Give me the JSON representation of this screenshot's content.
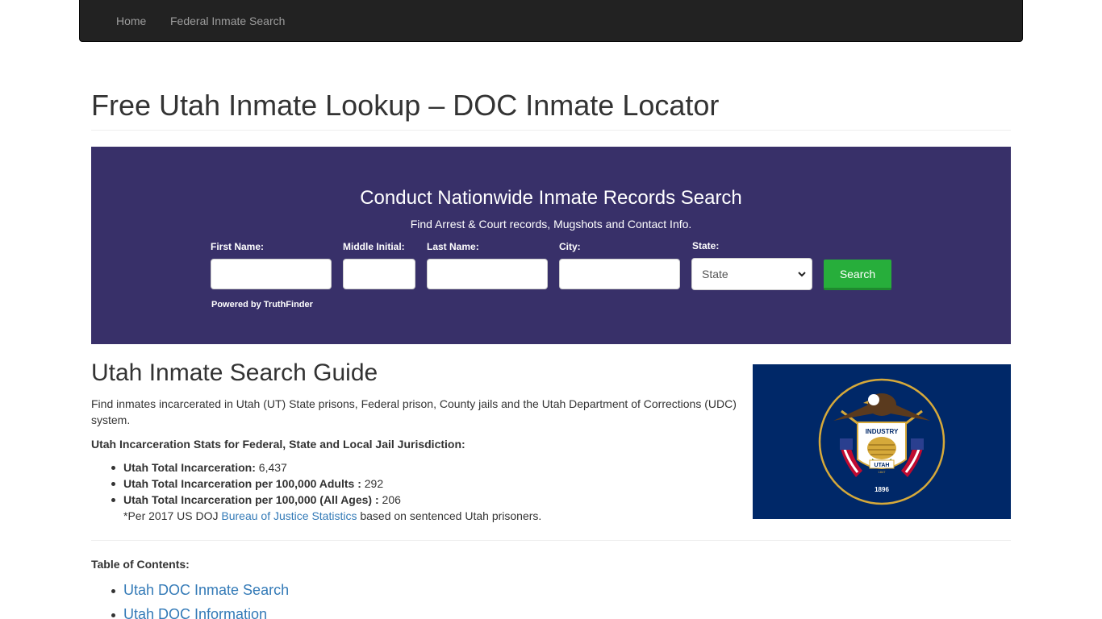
{
  "nav": {
    "home": "Home",
    "federal": "Federal Inmate Search"
  },
  "page": {
    "title": "Free Utah Inmate Lookup – DOC Inmate Locator"
  },
  "search": {
    "heading": "Conduct Nationwide Inmate Records Search",
    "subheading": "Find Arrest & Court records, Mugshots and Contact Info.",
    "first_name_label": "First Name:",
    "middle_initial_label": "Middle Initial:",
    "last_name_label": "Last Name:",
    "city_label": "City:",
    "state_label": "State:",
    "state_selected": "State",
    "button_label": "Search",
    "powered_by": "Powered by TruthFinder"
  },
  "guide": {
    "heading": "Utah Inmate Search Guide",
    "intro": "Find inmates incarcerated in Utah (UT) State prisons, Federal prison, County jails and the Utah Department of Corrections (UDC) system.",
    "stats_heading": "Utah Incarceration Stats for Federal, State and Local Jail Jurisdiction:",
    "stats": [
      {
        "label": "Utah Total Incarceration:",
        "value": " 6,437"
      },
      {
        "label": "Utah Total Incarceration per 100,000 Adults :",
        "value": " 292"
      },
      {
        "label": "Utah Total Incarceration per 100,000 (All Ages) :",
        "value": " 206"
      }
    ],
    "note_prefix": "*Per 2017 US DOJ ",
    "note_link": "Bureau of Justice Statistics",
    "note_suffix": " based on sentenced Utah prisoners."
  },
  "flag": {
    "banner_text": "INDUSTRY",
    "state_text": "UTAH",
    "year_small": "1847",
    "year": "1896",
    "colors": {
      "field": "#002868",
      "gold": "#d6a93a",
      "red": "#bf0a30",
      "white": "#ffffff"
    }
  },
  "toc": {
    "heading": "Table of Contents:",
    "items": [
      "Utah DOC Inmate Search",
      "Utah DOC Information"
    ]
  },
  "colors": {
    "navbar": "#222222",
    "banner": "#383069",
    "search_button": "#27ae3b",
    "link": "#337ab7"
  }
}
